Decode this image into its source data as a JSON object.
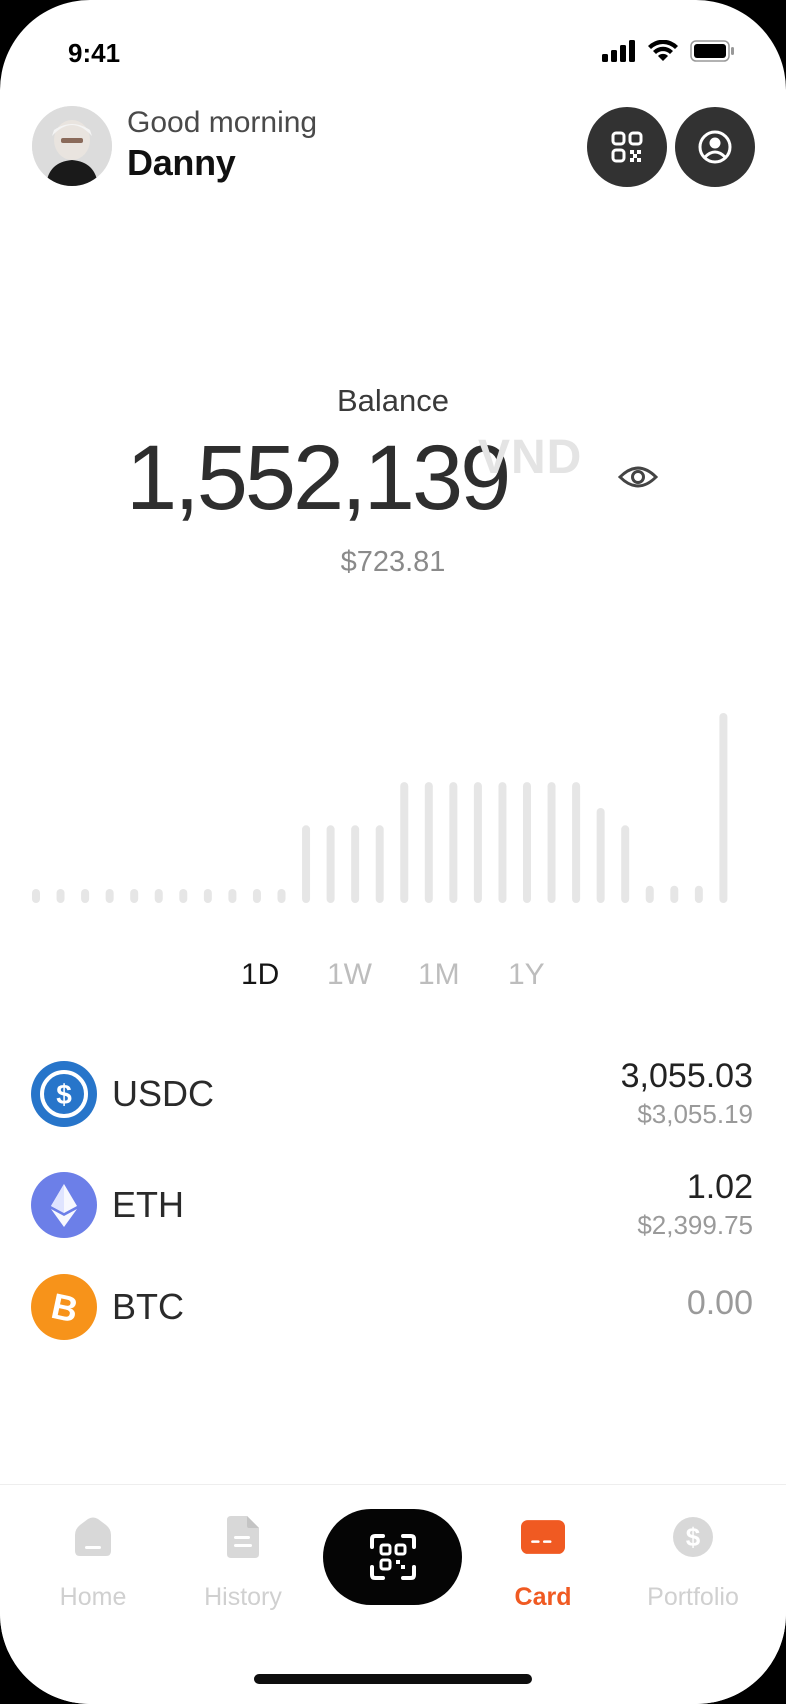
{
  "status_bar": {
    "time": "9:41"
  },
  "header": {
    "greeting": "Good morning",
    "user_name": "Danny"
  },
  "balance": {
    "label": "Balance",
    "amount": "1,552,139",
    "currency": "VND",
    "usd_value": "$723.81"
  },
  "chart_data": {
    "type": "bar",
    "values": [
      1,
      1,
      1,
      1,
      1,
      1,
      1,
      1,
      1,
      1,
      1,
      9,
      9,
      9,
      9,
      14,
      14,
      14,
      14,
      14,
      14,
      14,
      14,
      11,
      9,
      2,
      2,
      2,
      22
    ],
    "note_type_colors": {
      "bar": "#e6e6e6"
    }
  },
  "ranges": [
    "1D",
    "1W",
    "1M",
    "1Y"
  ],
  "active_range": "1D",
  "assets": [
    {
      "symbol": "USDC",
      "amount": "3,055.03",
      "usd": "$3,055.19",
      "color": "#2775CA"
    },
    {
      "symbol": "ETH",
      "amount": "1.02",
      "usd": "$2,399.75",
      "color": "#6C7FE8"
    },
    {
      "symbol": "BTC",
      "amount": "0.00",
      "usd": "",
      "color": "#F7931A"
    }
  ],
  "nav": {
    "home": "Home",
    "history": "History",
    "card": "Card",
    "portfolio": "Portfolio",
    "active": "Card",
    "accent": "#F05A22"
  }
}
